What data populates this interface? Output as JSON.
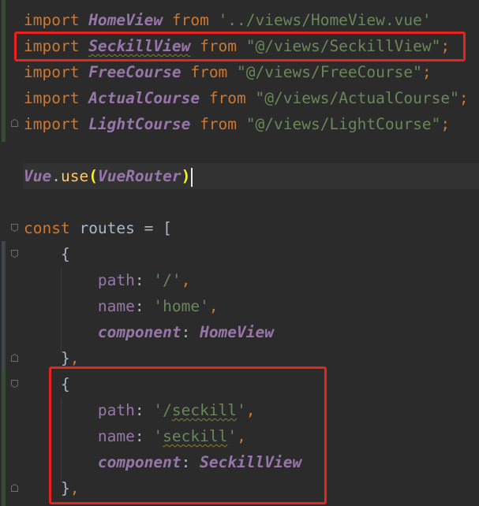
{
  "editor": {
    "lines": [
      {
        "tokens": [
          {
            "t": "import ",
            "c": "kw"
          },
          {
            "t": "HomeView",
            "c": "id"
          },
          {
            "t": " from ",
            "c": "kw"
          },
          {
            "t": "'../views/HomeView.vue'",
            "c": "str"
          }
        ]
      },
      {
        "tokens": [
          {
            "t": "import ",
            "c": "kw"
          },
          {
            "t": "SeckillView",
            "c": "id squiggle"
          },
          {
            "t": " from ",
            "c": "kw"
          },
          {
            "t": "\"@/views/SeckillView\"",
            "c": "str"
          },
          {
            "t": ";",
            "c": "kw"
          }
        ]
      },
      {
        "tokens": [
          {
            "t": "import ",
            "c": "kw"
          },
          {
            "t": "FreeCourse",
            "c": "id"
          },
          {
            "t": " from ",
            "c": "kw"
          },
          {
            "t": "\"@/views/FreeCourse\"",
            "c": "str"
          },
          {
            "t": ";",
            "c": "kw"
          }
        ]
      },
      {
        "tokens": [
          {
            "t": "import ",
            "c": "kw"
          },
          {
            "t": "ActualCourse",
            "c": "id"
          },
          {
            "t": " from ",
            "c": "kw"
          },
          {
            "t": "\"@/views/ActualCourse\"",
            "c": "str"
          },
          {
            "t": ";",
            "c": "kw"
          }
        ]
      },
      {
        "tokens": [
          {
            "t": "import ",
            "c": "kw"
          },
          {
            "t": "LightCourse",
            "c": "id"
          },
          {
            "t": " from ",
            "c": "kw"
          },
          {
            "t": "\"@/views/LightCourse\"",
            "c": "str"
          },
          {
            "t": ";",
            "c": "kw"
          }
        ]
      },
      {
        "tokens": []
      },
      {
        "caret": true,
        "tokens": [
          {
            "t": "Vue",
            "c": "id-light"
          },
          {
            "t": ".",
            "c": "plain"
          },
          {
            "t": "use",
            "c": "fn"
          },
          {
            "t": "(",
            "c": "paren-match"
          },
          {
            "t": "VueRouter",
            "c": "id-light"
          },
          {
            "t": ")",
            "c": "paren-match"
          }
        ]
      },
      {
        "tokens": []
      },
      {
        "tokens": [
          {
            "t": "const ",
            "c": "kw"
          },
          {
            "t": "routes = [",
            "c": "plain"
          }
        ]
      },
      {
        "tokens": [
          {
            "t": "    {",
            "c": "plain"
          }
        ]
      },
      {
        "tokens": [
          {
            "t": "        path",
            "c": "prop"
          },
          {
            "t": ": ",
            "c": "plain"
          },
          {
            "t": "'/'",
            "c": "str"
          },
          {
            "t": ",",
            "c": "kw"
          }
        ]
      },
      {
        "tokens": [
          {
            "t": "        name",
            "c": "prop"
          },
          {
            "t": ": ",
            "c": "plain"
          },
          {
            "t": "'home'",
            "c": "str"
          },
          {
            "t": ",",
            "c": "kw"
          }
        ]
      },
      {
        "tokens": [
          {
            "t": "        ",
            "c": "plain"
          },
          {
            "t": "component",
            "c": "id"
          },
          {
            "t": ": ",
            "c": "plain"
          },
          {
            "t": "HomeView",
            "c": "id"
          }
        ]
      },
      {
        "tokens": [
          {
            "t": "    }",
            "c": "plain"
          },
          {
            "t": ",",
            "c": "kw"
          }
        ]
      },
      {
        "tokens": [
          {
            "t": "    {",
            "c": "plain"
          }
        ]
      },
      {
        "tokens": [
          {
            "t": "        path",
            "c": "prop"
          },
          {
            "t": ": ",
            "c": "plain"
          },
          {
            "t": "'/",
            "c": "str"
          },
          {
            "t": "seckill",
            "c": "str squiggle"
          },
          {
            "t": "'",
            "c": "str"
          },
          {
            "t": ",",
            "c": "kw"
          }
        ]
      },
      {
        "tokens": [
          {
            "t": "        name",
            "c": "prop"
          },
          {
            "t": ": ",
            "c": "plain"
          },
          {
            "t": "'",
            "c": "str"
          },
          {
            "t": "seckill",
            "c": "str squiggle"
          },
          {
            "t": "'",
            "c": "str"
          },
          {
            "t": ",",
            "c": "kw"
          }
        ]
      },
      {
        "tokens": [
          {
            "t": "        ",
            "c": "plain"
          },
          {
            "t": "component",
            "c": "id"
          },
          {
            "t": ": ",
            "c": "plain"
          },
          {
            "t": "SeckillView",
            "c": "id"
          }
        ]
      },
      {
        "tokens": [
          {
            "t": "    }",
            "c": "plain"
          },
          {
            "t": ",",
            "c": "kw"
          }
        ]
      }
    ]
  },
  "colors": {
    "background": "#2b2b2b",
    "keyword": "#cc7832",
    "identifier": "#9876aa",
    "string": "#6a8759",
    "plain": "#a9b7c6",
    "function": "#ffc66d",
    "highlight_box": "#e8231e"
  },
  "icons": [
    "fold-icon",
    "change-marker"
  ]
}
